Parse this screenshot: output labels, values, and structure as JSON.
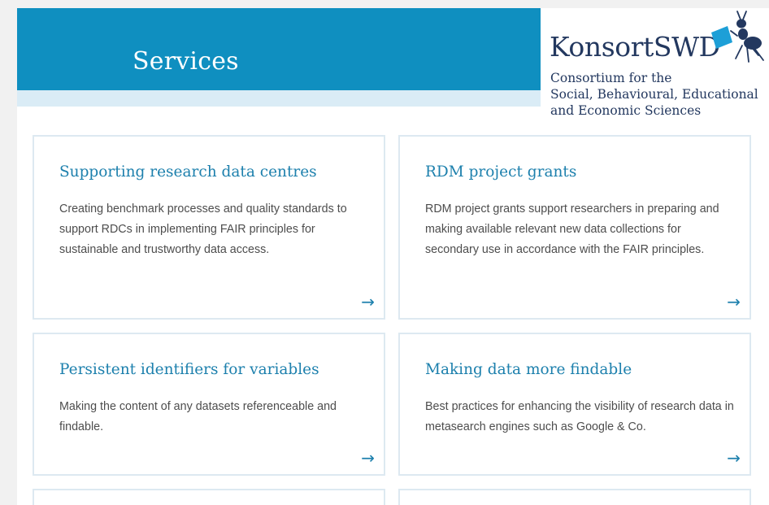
{
  "hero": {
    "title": "Services"
  },
  "logo": {
    "wordmark": "KonsortSWD",
    "subtitle_lines": [
      "Consortium for the",
      "Social, Behavioural, Educational",
      "and Economic Sciences"
    ]
  },
  "cards": [
    {
      "title": "Supporting research data centres",
      "text": "Creating benchmark processes and quality standards to support RDCs in implementing FAIR principles for sustainable and trustworthy data access.",
      "arrow": "→"
    },
    {
      "title": "RDM project grants",
      "text": "RDM project grants support researchers in preparing and making available relevant new data collections for secondary use in accordance with the FAIR principles.",
      "arrow": "→"
    },
    {
      "title": "Persistent identifiers for variables",
      "text": "Making the content of any datasets referenceable and findable.",
      "arrow": "→"
    },
    {
      "title": "Making data more findable",
      "text": "Best practices for enhancing the visibility of research data in metasearch engines such as Google & Co.",
      "arrow": "→"
    }
  ],
  "colors": {
    "hero_blue": "#0f8fc0",
    "accent": "#1d80ad",
    "logo_navy": "#23385f",
    "band": "#daecf6"
  }
}
